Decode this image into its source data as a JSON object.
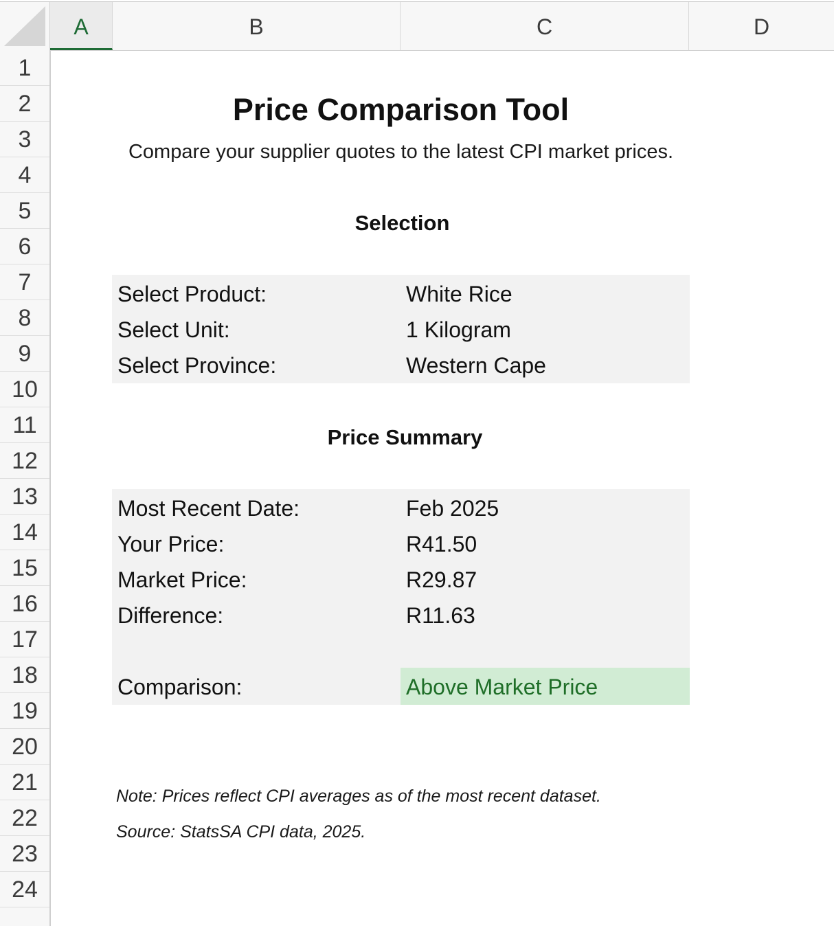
{
  "columns": [
    "A",
    "B",
    "C",
    "D"
  ],
  "selected_column": "A",
  "rows": [
    "1",
    "2",
    "3",
    "4",
    "5",
    "6",
    "7",
    "8",
    "9",
    "10",
    "11",
    "12",
    "13",
    "14",
    "15",
    "16",
    "17",
    "18",
    "19",
    "20",
    "21",
    "22",
    "23",
    "24"
  ],
  "sheet": {
    "title": "Price Comparison Tool",
    "subtitle": "Compare your supplier quotes to the latest CPI market prices.",
    "selection": {
      "heading": "Selection",
      "product_label": "Select Product:",
      "product_value": "White Rice",
      "unit_label": "Select Unit:",
      "unit_value": "1 Kilogram",
      "province_label": "Select Province:",
      "province_value": "Western Cape"
    },
    "summary": {
      "heading": "Price Summary",
      "date_label": "Most Recent Date:",
      "date_value": "Feb 2025",
      "your_price_label": "Your Price:",
      "your_price_value": "R41.50",
      "market_price_label": "Market Price:",
      "market_price_value": "R29.87",
      "difference_label": "Difference:",
      "difference_value": "R11.63",
      "comparison_label": "Comparison:",
      "comparison_value": "Above Market Price"
    },
    "note": "Note: Prices reflect CPI averages as of the most recent dataset.",
    "source": "Source: StatsSA CPI data, 2025."
  },
  "colors": {
    "selected_header": "#1e6b35",
    "cell_fill": "#f2f2f2",
    "comparison_fill": "#d1ecd4",
    "comparison_text": "#1f6e28"
  }
}
